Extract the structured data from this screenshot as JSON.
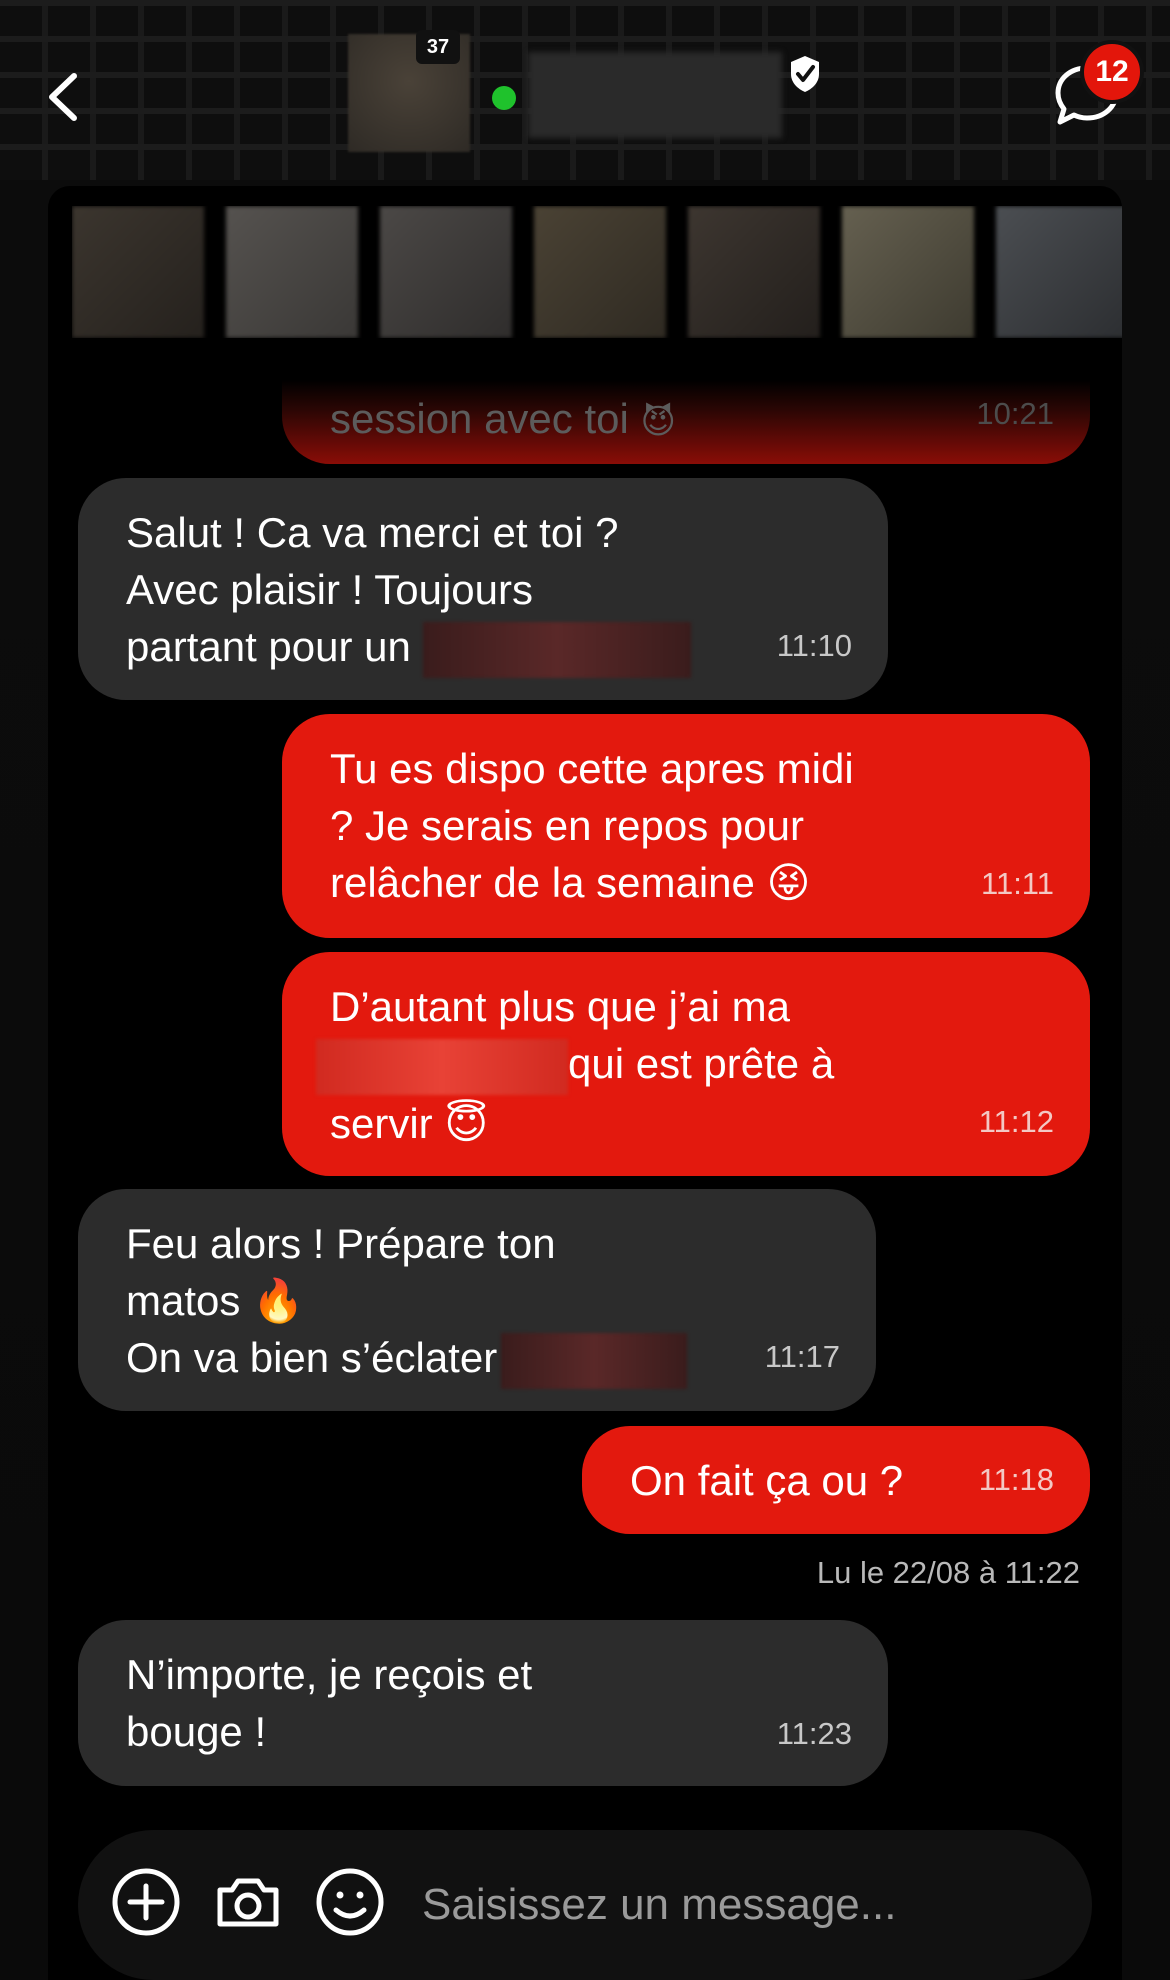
{
  "header": {
    "age_badge": "37",
    "notification_count": "12"
  },
  "messages": [
    {
      "id": "m0",
      "direction": "out",
      "lines": [
        "session avec toi"
      ],
      "time": "10:21",
      "partial": true
    },
    {
      "id": "m1",
      "direction": "in",
      "lines": [
        "Salut ! Ca va merci et toi ?",
        "Avec plaisir ! Toujours",
        "partant pour un"
      ],
      "time": "11:10"
    },
    {
      "id": "m2",
      "direction": "out",
      "lines": [
        "Tu es dispo cette apres midi",
        "? Je serais en repos pour",
        "relâcher de la semaine"
      ],
      "emoji": "😝",
      "time": "11:11"
    },
    {
      "id": "m3",
      "direction": "out",
      "lines": [
        "D’autant plus que j’ai ma",
        "qui est prête à",
        "servir"
      ],
      "emoji": "😇",
      "time": "11:12"
    },
    {
      "id": "m4",
      "direction": "in",
      "lines": [
        "Feu alors ! Prépare ton",
        "matos",
        "On va bien s’éclater"
      ],
      "emoji": "🔥",
      "time": "11:17"
    },
    {
      "id": "m5",
      "direction": "out",
      "lines": [
        "On fait ça ou ?"
      ],
      "time": "11:18"
    },
    {
      "id": "m6",
      "direction": "in",
      "lines": [
        "N’importe, je reçois et",
        "bouge !"
      ],
      "time": "11:23"
    }
  ],
  "read_receipt": "Lu le 22/08 à 11:22",
  "composer": {
    "placeholder": "Saisissez un message..."
  },
  "colors": {
    "outgoing_bubble": "#e3190e",
    "incoming_bubble": "#2c2c2c",
    "online": "#1fc22c",
    "badge": "#e3160b"
  },
  "icons": [
    "back-chevron-icon",
    "verified-shield-icon",
    "chat-bubble-icon",
    "add-icon",
    "camera-icon",
    "emoji-icon"
  ]
}
